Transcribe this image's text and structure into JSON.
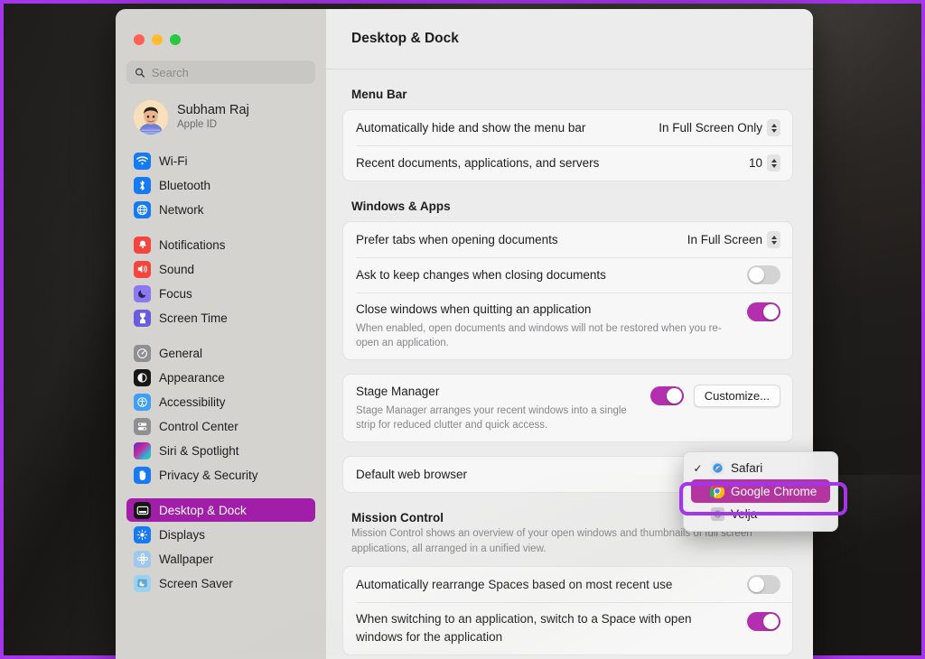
{
  "window": {
    "title": "Desktop & Dock",
    "traffic_lights": [
      "close",
      "minimize",
      "zoom"
    ]
  },
  "sidebar": {
    "search": {
      "placeholder": "Search",
      "value": "",
      "icon": "search-icon"
    },
    "profile": {
      "name": "Subham Raj",
      "subtitle": "Apple ID",
      "avatar": "memoji-avatar"
    },
    "groups": [
      {
        "items": [
          {
            "label": "Wi-Fi",
            "icon": "wifi-icon"
          },
          {
            "label": "Bluetooth",
            "icon": "bluetooth-icon"
          },
          {
            "label": "Network",
            "icon": "network-globe-icon"
          }
        ]
      },
      {
        "items": [
          {
            "label": "Notifications",
            "icon": "notifications-bell-icon"
          },
          {
            "label": "Sound",
            "icon": "sound-speaker-icon"
          },
          {
            "label": "Focus",
            "icon": "focus-moon-icon"
          },
          {
            "label": "Screen Time",
            "icon": "screen-time-hourglass-icon"
          }
        ]
      },
      {
        "items": [
          {
            "label": "General",
            "icon": "general-gear-icon"
          },
          {
            "label": "Appearance",
            "icon": "appearance-contrast-icon"
          },
          {
            "label": "Accessibility",
            "icon": "accessibility-person-icon"
          },
          {
            "label": "Control Center",
            "icon": "control-center-icon"
          },
          {
            "label": "Siri & Spotlight",
            "icon": "siri-orb-icon"
          },
          {
            "label": "Privacy & Security",
            "icon": "privacy-hand-icon"
          }
        ]
      },
      {
        "items": [
          {
            "label": "Desktop & Dock",
            "icon": "desktop-dock-icon",
            "selected": true
          },
          {
            "label": "Displays",
            "icon": "displays-brightness-icon"
          },
          {
            "label": "Wallpaper",
            "icon": "wallpaper-flower-icon"
          },
          {
            "label": "Screen Saver",
            "icon": "screen-saver-icon"
          }
        ]
      }
    ]
  },
  "main": {
    "sections": [
      {
        "title": "Menu Bar",
        "rows": [
          {
            "label": "Automatically hide and show the menu bar",
            "control": "popup",
            "value": "In Full Screen Only"
          },
          {
            "label": "Recent documents, applications, and servers",
            "control": "popup",
            "value": "10"
          }
        ]
      },
      {
        "title": "Windows & Apps",
        "rows": [
          {
            "label": "Prefer tabs when opening documents",
            "control": "popup",
            "value": "In Full Screen"
          },
          {
            "label": "Ask to keep changes when closing documents",
            "control": "toggle",
            "value": "off"
          },
          {
            "label": "Close windows when quitting an application",
            "desc": "When enabled, open documents and windows will not be restored when you re-open an application.",
            "control": "toggle",
            "value": "on"
          }
        ]
      },
      {
        "title": "",
        "rows": [
          {
            "label": "Stage Manager",
            "desc": "Stage Manager arranges your recent windows into a single strip for reduced clutter and quick access.",
            "control": "toggle-button",
            "value": "on",
            "button": "Customize..."
          }
        ]
      },
      {
        "title": "",
        "rows": [
          {
            "label": "Default web browser",
            "control": "popup",
            "value": ""
          }
        ]
      },
      {
        "title": "Mission Control",
        "desc": "Mission Control shows an overview of your open windows and thumbnails of full screen applications, all arranged in a unified view.",
        "rows": [
          {
            "label": "Automatically rearrange Spaces based on most recent use",
            "control": "toggle",
            "value": "off"
          },
          {
            "label": "When switching to an application, switch to a Space with open windows for the application",
            "control": "toggle",
            "value": "on"
          }
        ]
      }
    ]
  },
  "browser_menu": {
    "items": [
      {
        "label": "Safari",
        "checked": true,
        "icon": "safari-compass-icon",
        "highlighted": false
      },
      {
        "label": "Google Chrome",
        "checked": false,
        "icon": "chrome-icon",
        "highlighted": true
      },
      {
        "label": "Velja",
        "checked": false,
        "icon": "velja-icon",
        "highlighted": false
      }
    ]
  },
  "colors": {
    "accent_purple": "#a01ea8",
    "toggle_on": "#b32fae",
    "annotation_border": "#a435e8",
    "menu_highlight": "#b4359f"
  }
}
